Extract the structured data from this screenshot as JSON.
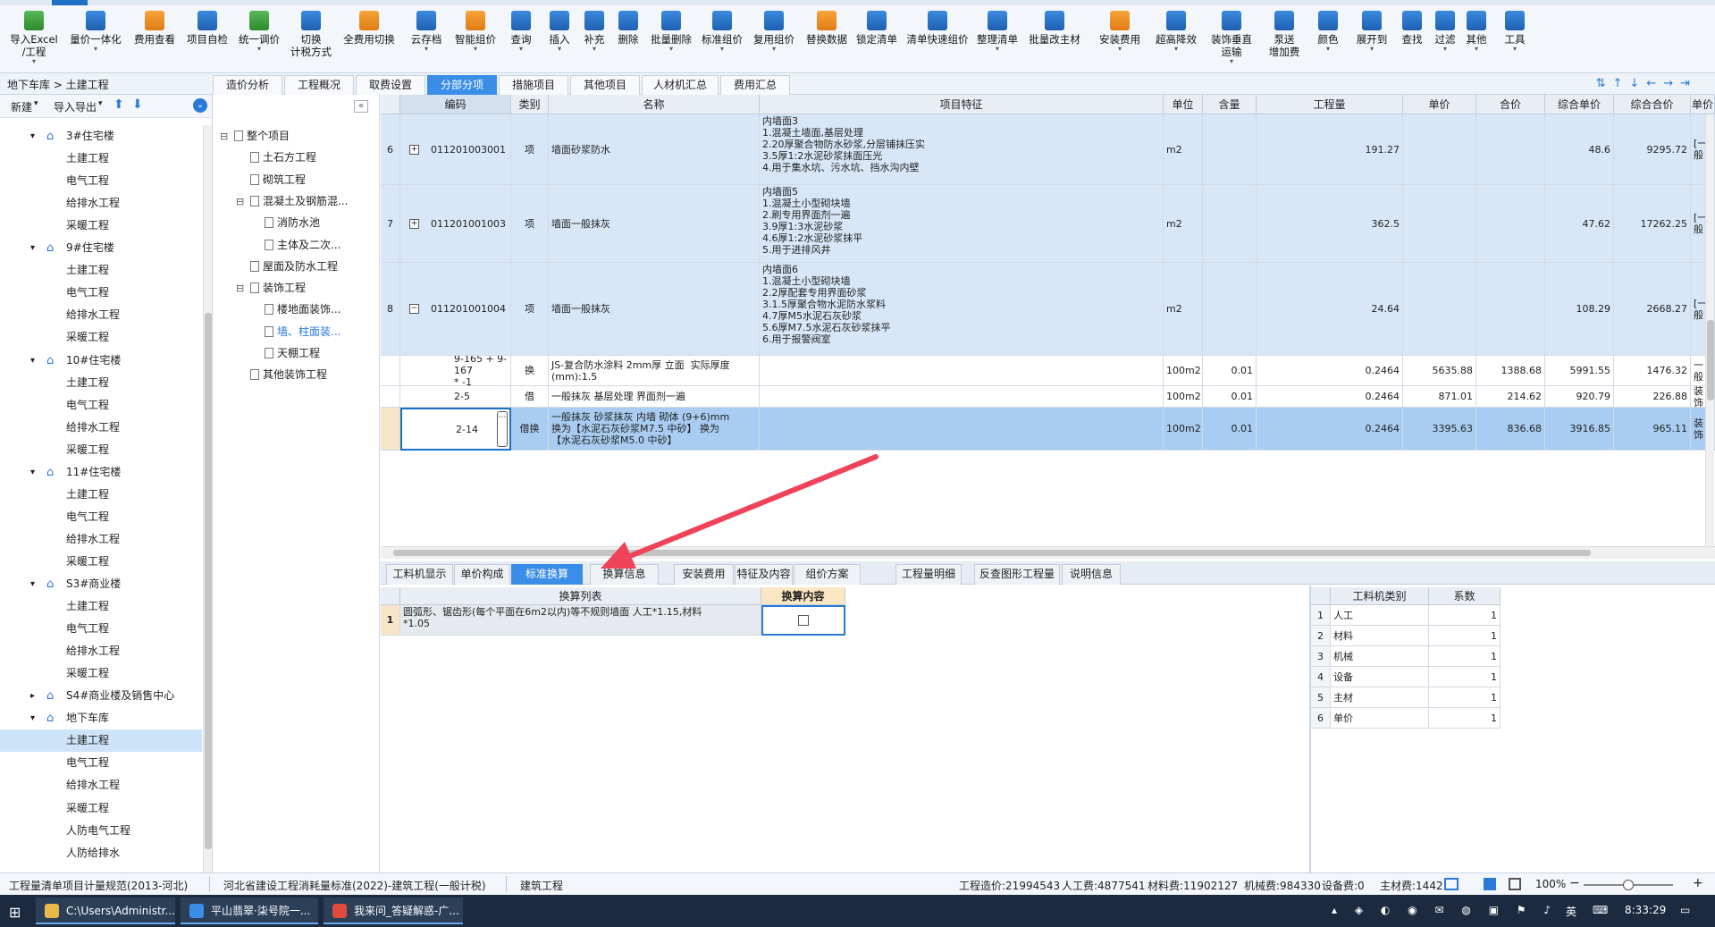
{
  "ribbon": {
    "buttons": [
      {
        "label": "导入Excel\n/工程",
        "icon": "import-excel-icon",
        "c": "g",
        "dd": "▾"
      },
      {
        "label": "量价一体化",
        "icon": "integrate-icon",
        "c": "b",
        "dd": "▾"
      },
      {
        "label": "费用查看",
        "icon": "fee-view-icon",
        "c": "o",
        "dd": ""
      },
      {
        "label": "项目自检",
        "icon": "self-check-icon",
        "c": "b",
        "dd": ""
      },
      {
        "label": "统一调价",
        "icon": "adjust-price-icon",
        "c": "g",
        "dd": "▾"
      },
      {
        "label": "切换\n计税方式",
        "icon": "tax-mode-icon",
        "c": "b",
        "dd": ""
      },
      {
        "label": "全费用切换",
        "icon": "full-fee-icon",
        "c": "o",
        "dd": ""
      },
      {
        "label": "云存档",
        "icon": "cloud-icon",
        "c": "b",
        "dd": "▾"
      },
      {
        "label": "智能组价",
        "icon": "smart-price-icon",
        "c": "o",
        "dd": "▾"
      },
      {
        "label": "查询",
        "icon": "query-icon",
        "c": "b",
        "dd": "▾"
      },
      {
        "label": "插入",
        "icon": "insert-icon",
        "c": "b",
        "dd": "▾"
      },
      {
        "label": "补充",
        "icon": "supplement-icon",
        "c": "b",
        "dd": "▾"
      },
      {
        "label": "删除",
        "icon": "delete-icon",
        "c": "b",
        "dd": ""
      },
      {
        "label": "批量删除",
        "icon": "batch-delete-icon",
        "c": "b",
        "dd": "▾"
      },
      {
        "label": "标准组价",
        "icon": "standard-price-icon",
        "c": "b",
        "dd": "▾"
      },
      {
        "label": "复用组价",
        "icon": "reuse-price-icon",
        "c": "b",
        "dd": "▾"
      },
      {
        "label": "替换数据",
        "icon": "replace-data-icon",
        "c": "o",
        "dd": ""
      },
      {
        "label": "锁定清单",
        "icon": "lock-icon",
        "c": "b",
        "dd": ""
      },
      {
        "label": "清单快速组价",
        "icon": "quick-price-icon",
        "c": "b",
        "dd": ""
      },
      {
        "label": "整理清单",
        "icon": "organize-icon",
        "c": "b",
        "dd": "▾"
      },
      {
        "label": "批量改主材",
        "icon": "batch-material-icon",
        "c": "b",
        "dd": ""
      },
      {
        "label": "安装费用",
        "icon": "install-fee-icon",
        "c": "o",
        "dd": "▾"
      },
      {
        "label": "超高降效",
        "icon": "high-rise-icon",
        "c": "b",
        "dd": "▾"
      },
      {
        "label": "装饰垂直\n运输",
        "icon": "vertical-transport-icon",
        "c": "b",
        "dd": "▾"
      },
      {
        "label": "泵送\n增加费",
        "icon": "pump-fee-icon",
        "c": "b",
        "dd": ""
      },
      {
        "label": "颜色",
        "icon": "color-icon",
        "c": "b",
        "dd": "▾"
      },
      {
        "label": "展开到",
        "icon": "expand-to-icon",
        "c": "b",
        "dd": "▾"
      },
      {
        "label": "查找",
        "icon": "find-icon",
        "c": "b",
        "dd": ""
      },
      {
        "label": "过滤",
        "icon": "filter-icon",
        "c": "b",
        "dd": "▾"
      },
      {
        "label": "其他",
        "icon": "other-icon",
        "c": "b",
        "dd": "▾"
      },
      {
        "label": "工具",
        "icon": "tools-icon",
        "c": "b",
        "dd": "▾"
      }
    ]
  },
  "nav": {
    "breadcrumb": "地下车库 > 土建工程",
    "tabs": [
      "造价分析",
      "工程概况",
      "取费设置",
      "分部分项",
      "措施项目",
      "其他项目",
      "人材机汇总",
      "费用汇总"
    ],
    "active_tab": "分部分项"
  },
  "left": {
    "new": "新建",
    "import_export": "导入导出",
    "tree": [
      {
        "label": "3#住宅楼",
        "level": 1,
        "exp": "▾"
      },
      {
        "label": "土建工程",
        "level": 2
      },
      {
        "label": "电气工程",
        "level": 2
      },
      {
        "label": "给排水工程",
        "level": 2
      },
      {
        "label": "采暖工程",
        "level": 2
      },
      {
        "label": "9#住宅楼",
        "level": 1,
        "exp": "▾"
      },
      {
        "label": "土建工程",
        "level": 2
      },
      {
        "label": "电气工程",
        "level": 2
      },
      {
        "label": "给排水工程",
        "level": 2
      },
      {
        "label": "采暖工程",
        "level": 2
      },
      {
        "label": "10#住宅楼",
        "level": 1,
        "exp": "▾"
      },
      {
        "label": "土建工程",
        "level": 2
      },
      {
        "label": "电气工程",
        "level": 2
      },
      {
        "label": "给排水工程",
        "level": 2
      },
      {
        "label": "采暖工程",
        "level": 2
      },
      {
        "label": "11#住宅楼",
        "level": 1,
        "exp": "▾"
      },
      {
        "label": "土建工程",
        "level": 2
      },
      {
        "label": "电气工程",
        "level": 2
      },
      {
        "label": "给排水工程",
        "level": 2
      },
      {
        "label": "采暖工程",
        "level": 2
      },
      {
        "label": "S3#商业楼",
        "level": 1,
        "exp": "▾"
      },
      {
        "label": "土建工程",
        "level": 2
      },
      {
        "label": "电气工程",
        "level": 2
      },
      {
        "label": "给排水工程",
        "level": 2
      },
      {
        "label": "采暖工程",
        "level": 2
      },
      {
        "label": "S4#商业楼及销售中心",
        "level": 1,
        "exp": "▸"
      },
      {
        "label": "地下车库",
        "level": 1,
        "exp": "▾"
      },
      {
        "label": "土建工程",
        "level": 2,
        "selected": true
      },
      {
        "label": "电气工程",
        "level": 2
      },
      {
        "label": "给排水工程",
        "level": 2
      },
      {
        "label": "采暖工程",
        "level": 2
      },
      {
        "label": "人防电气工程",
        "level": 2
      },
      {
        "label": "人防给排水",
        "level": 2
      }
    ]
  },
  "middle": {
    "tree": [
      {
        "label": "整个项目",
        "level": 0,
        "exp": "⊟"
      },
      {
        "label": "土石方工程",
        "level": 1
      },
      {
        "label": "砌筑工程",
        "level": 1
      },
      {
        "label": "混凝土及钢筋混...",
        "level": 1,
        "exp": "⊟"
      },
      {
        "label": "消防水池",
        "level": 2
      },
      {
        "label": "主体及二次...",
        "level": 2
      },
      {
        "label": "屋面及防水工程",
        "level": 1
      },
      {
        "label": "装饰工程",
        "level": 1,
        "exp": "⊟"
      },
      {
        "label": "楼地面装饰...",
        "level": 2
      },
      {
        "label": "墙、柱面装...",
        "level": 2,
        "hl": true
      },
      {
        "label": "天棚工程",
        "level": 2
      },
      {
        "label": "其他装饰工程",
        "level": 1
      }
    ]
  },
  "grid": {
    "headers": [
      "编码",
      "类别",
      "名称",
      "项目特征",
      "单位",
      "含量",
      "工程量",
      "单价",
      "合价",
      "综合单价",
      "综合合价",
      "单价"
    ],
    "rows": [
      {
        "no": "6",
        "code": "011201003001",
        "exp": "+",
        "type": "项",
        "name": "墙面砂浆防水",
        "feature": "内墙面3\n1.混凝土墙面,基层处理\n2.20厚聚合物防水砂浆,分层铺抹压实\n3.5厚1:2水泥砂浆抹面压光\n4.用于集水坑、污水坑、挡水沟内壁",
        "unit": "m2",
        "content": "",
        "qty": "191.27",
        "price": "",
        "total": "",
        "uprice": "48.6",
        "utotal": "9295.72",
        "last": "[一般"
      },
      {
        "no": "7",
        "code": "011201001003",
        "exp": "+",
        "type": "项",
        "name": "墙面一般抹灰",
        "feature": "内墙面5\n1.混凝土小型砌块墙\n2.刷专用界面剂一遍\n3.9厚1:3水泥砂浆\n4.6厚1:2水泥砂浆抹平\n5.用于进排风井",
        "unit": "m2",
        "content": "",
        "qty": "362.5",
        "price": "",
        "total": "",
        "uprice": "47.62",
        "utotal": "17262.25",
        "last": "[一般"
      },
      {
        "no": "8",
        "code": "011201001004",
        "exp": "−",
        "type": "项",
        "name": "墙面一般抹灰",
        "feature": "内墙面6\n1.混凝土小型砌块墙\n2.2厚配套专用界面砂浆\n3.1.5厚聚合物水泥防水浆料\n4.7厚M5水泥石灰砂浆\n5.6厚M7.5水泥石灰砂浆抹平\n6.用于报警阀室",
        "unit": "m2",
        "content": "",
        "qty": "24.64",
        "price": "",
        "total": "",
        "uprice": "108.29",
        "utotal": "2668.27",
        "last": "[一般"
      },
      {
        "no": "",
        "code": "9-165 + 9-167\n* -1",
        "exp": "",
        "type": "换",
        "name": "JS-复合防水涂料 2mm厚 立面  实际厚度\n(mm):1.5",
        "feature": "",
        "unit": "100m2",
        "content": "0.01",
        "qty": "0.2464",
        "price": "5635.88",
        "total": "1388.68",
        "uprice": "5991.55",
        "utotal": "1476.32",
        "last": "一般"
      },
      {
        "no": "",
        "code": "2-5",
        "exp": "",
        "type": "借",
        "name": "一般抹灰 基层处理 界面剂一遍",
        "feature": "",
        "unit": "100m2",
        "content": "0.01",
        "qty": "0.2464",
        "price": "871.01",
        "total": "214.62",
        "uprice": "920.79",
        "utotal": "226.88",
        "last": "装饰"
      },
      {
        "no": "",
        "code": "2-14",
        "exp": "",
        "type": "借换",
        "name": "一般抹灰 砂浆抹灰 内墙 砌体 (9+6)mm\n换为【水泥石灰砂浆M7.5 中砂】 换为\n【水泥石灰砂浆M5.0 中砂】",
        "feature": "",
        "unit": "100m2",
        "content": "0.01",
        "qty": "0.2464",
        "price": "3395.63",
        "total": "836.68",
        "uprice": "3916.85",
        "utotal": "965.11",
        "last": "装饰"
      }
    ]
  },
  "bottom_tabs": [
    "工料机显示",
    "单价构成",
    "标准换算",
    "换算信息",
    "安装费用",
    "特征及内容",
    "组价方案",
    "工程量明细",
    "反查图形工程量",
    "说明信息"
  ],
  "bottom_active": "标准换算",
  "conv": {
    "headers": [
      "换算列表",
      "换算内容"
    ],
    "rows": [
      {
        "no": "1",
        "text": "圆弧形、锯齿形(每个平面在6m2以内)等不规则墙面 人工*1.15,材料\n*1.05",
        "checked": false
      }
    ]
  },
  "coef": {
    "headers": [
      "工料机类别",
      "系数"
    ],
    "rows": [
      {
        "no": "1",
        "name": "人工",
        "val": "1"
      },
      {
        "no": "2",
        "name": "材料",
        "val": "1"
      },
      {
        "no": "3",
        "name": "机械",
        "val": "1"
      },
      {
        "no": "4",
        "name": "设备",
        "val": "1"
      },
      {
        "no": "5",
        "name": "主材",
        "val": "1"
      },
      {
        "no": "6",
        "name": "单价",
        "val": "1"
      }
    ]
  },
  "status": {
    "spec": "工程量清单项目计量规范(2013-河北)",
    "quota": "河北省建设工程消耗量标准(2022)-建筑工程(一般计税)",
    "type": "建筑工程",
    "cost": "工程造价:21994543",
    "labor": "人工费:4877541",
    "material": "材料费:11902127",
    "machine": "机械费:984330",
    "equip": "设备费:0",
    "main": "主材费:1442",
    "zoom": "100%"
  },
  "taskbar": {
    "items": [
      "C:\\Users\\Administr...",
      "平山翡翠·柒号院一...",
      "我来问_答疑解惑-广..."
    ],
    "ime": "英",
    "time": "8:33:29"
  },
  "accent": "#3b8ee8",
  "arrow_color": "#f0435a"
}
